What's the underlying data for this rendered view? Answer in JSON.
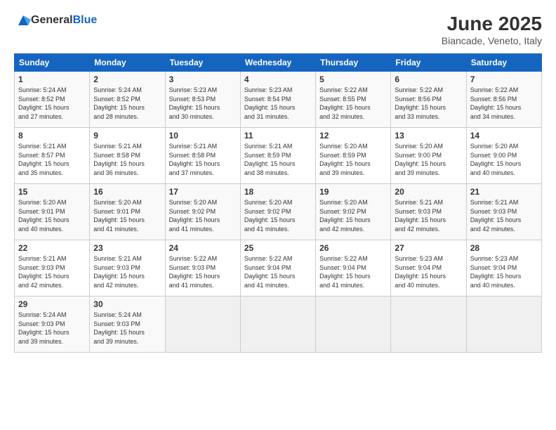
{
  "logo": {
    "general": "General",
    "blue": "Blue"
  },
  "title": "June 2025",
  "subtitle": "Biancade, Veneto, Italy",
  "days": [
    "Sunday",
    "Monday",
    "Tuesday",
    "Wednesday",
    "Thursday",
    "Friday",
    "Saturday"
  ],
  "weeks": [
    [
      {
        "day": "1",
        "lines": [
          "Sunrise: 5:24 AM",
          "Sunset: 8:52 PM",
          "Daylight: 15 hours",
          "and 27 minutes."
        ]
      },
      {
        "day": "2",
        "lines": [
          "Sunrise: 5:24 AM",
          "Sunset: 8:52 PM",
          "Daylight: 15 hours",
          "and 28 minutes."
        ]
      },
      {
        "day": "3",
        "lines": [
          "Sunrise: 5:23 AM",
          "Sunset: 8:53 PM",
          "Daylight: 15 hours",
          "and 30 minutes."
        ]
      },
      {
        "day": "4",
        "lines": [
          "Sunrise: 5:23 AM",
          "Sunset: 8:54 PM",
          "Daylight: 15 hours",
          "and 31 minutes."
        ]
      },
      {
        "day": "5",
        "lines": [
          "Sunrise: 5:22 AM",
          "Sunset: 8:55 PM",
          "Daylight: 15 hours",
          "and 32 minutes."
        ]
      },
      {
        "day": "6",
        "lines": [
          "Sunrise: 5:22 AM",
          "Sunset: 8:56 PM",
          "Daylight: 15 hours",
          "and 33 minutes."
        ]
      },
      {
        "day": "7",
        "lines": [
          "Sunrise: 5:22 AM",
          "Sunset: 8:56 PM",
          "Daylight: 15 hours",
          "and 34 minutes."
        ]
      }
    ],
    [
      {
        "day": "8",
        "lines": [
          "Sunrise: 5:21 AM",
          "Sunset: 8:57 PM",
          "Daylight: 15 hours",
          "and 35 minutes."
        ]
      },
      {
        "day": "9",
        "lines": [
          "Sunrise: 5:21 AM",
          "Sunset: 8:58 PM",
          "Daylight: 15 hours",
          "and 36 minutes."
        ]
      },
      {
        "day": "10",
        "lines": [
          "Sunrise: 5:21 AM",
          "Sunset: 8:58 PM",
          "Daylight: 15 hours",
          "and 37 minutes."
        ]
      },
      {
        "day": "11",
        "lines": [
          "Sunrise: 5:21 AM",
          "Sunset: 8:59 PM",
          "Daylight: 15 hours",
          "and 38 minutes."
        ]
      },
      {
        "day": "12",
        "lines": [
          "Sunrise: 5:20 AM",
          "Sunset: 8:59 PM",
          "Daylight: 15 hours",
          "and 39 minutes."
        ]
      },
      {
        "day": "13",
        "lines": [
          "Sunrise: 5:20 AM",
          "Sunset: 9:00 PM",
          "Daylight: 15 hours",
          "and 39 minutes."
        ]
      },
      {
        "day": "14",
        "lines": [
          "Sunrise: 5:20 AM",
          "Sunset: 9:00 PM",
          "Daylight: 15 hours",
          "and 40 minutes."
        ]
      }
    ],
    [
      {
        "day": "15",
        "lines": [
          "Sunrise: 5:20 AM",
          "Sunset: 9:01 PM",
          "Daylight: 15 hours",
          "and 40 minutes."
        ]
      },
      {
        "day": "16",
        "lines": [
          "Sunrise: 5:20 AM",
          "Sunset: 9:01 PM",
          "Daylight: 15 hours",
          "and 41 minutes."
        ]
      },
      {
        "day": "17",
        "lines": [
          "Sunrise: 5:20 AM",
          "Sunset: 9:02 PM",
          "Daylight: 15 hours",
          "and 41 minutes."
        ]
      },
      {
        "day": "18",
        "lines": [
          "Sunrise: 5:20 AM",
          "Sunset: 9:02 PM",
          "Daylight: 15 hours",
          "and 41 minutes."
        ]
      },
      {
        "day": "19",
        "lines": [
          "Sunrise: 5:20 AM",
          "Sunset: 9:02 PM",
          "Daylight: 15 hours",
          "and 42 minutes."
        ]
      },
      {
        "day": "20",
        "lines": [
          "Sunrise: 5:21 AM",
          "Sunset: 9:03 PM",
          "Daylight: 15 hours",
          "and 42 minutes."
        ]
      },
      {
        "day": "21",
        "lines": [
          "Sunrise: 5:21 AM",
          "Sunset: 9:03 PM",
          "Daylight: 15 hours",
          "and 42 minutes."
        ]
      }
    ],
    [
      {
        "day": "22",
        "lines": [
          "Sunrise: 5:21 AM",
          "Sunset: 9:03 PM",
          "Daylight: 15 hours",
          "and 42 minutes."
        ]
      },
      {
        "day": "23",
        "lines": [
          "Sunrise: 5:21 AM",
          "Sunset: 9:03 PM",
          "Daylight: 15 hours",
          "and 42 minutes."
        ]
      },
      {
        "day": "24",
        "lines": [
          "Sunrise: 5:22 AM",
          "Sunset: 9:03 PM",
          "Daylight: 15 hours",
          "and 41 minutes."
        ]
      },
      {
        "day": "25",
        "lines": [
          "Sunrise: 5:22 AM",
          "Sunset: 9:04 PM",
          "Daylight: 15 hours",
          "and 41 minutes."
        ]
      },
      {
        "day": "26",
        "lines": [
          "Sunrise: 5:22 AM",
          "Sunset: 9:04 PM",
          "Daylight: 15 hours",
          "and 41 minutes."
        ]
      },
      {
        "day": "27",
        "lines": [
          "Sunrise: 5:23 AM",
          "Sunset: 9:04 PM",
          "Daylight: 15 hours",
          "and 40 minutes."
        ]
      },
      {
        "day": "28",
        "lines": [
          "Sunrise: 5:23 AM",
          "Sunset: 9:04 PM",
          "Daylight: 15 hours",
          "and 40 minutes."
        ]
      }
    ],
    [
      {
        "day": "29",
        "lines": [
          "Sunrise: 5:24 AM",
          "Sunset: 9:03 PM",
          "Daylight: 15 hours",
          "and 39 minutes."
        ]
      },
      {
        "day": "30",
        "lines": [
          "Sunrise: 5:24 AM",
          "Sunset: 9:03 PM",
          "Daylight: 15 hours",
          "and 39 minutes."
        ]
      },
      {
        "day": "",
        "lines": []
      },
      {
        "day": "",
        "lines": []
      },
      {
        "day": "",
        "lines": []
      },
      {
        "day": "",
        "lines": []
      },
      {
        "day": "",
        "lines": []
      }
    ]
  ]
}
